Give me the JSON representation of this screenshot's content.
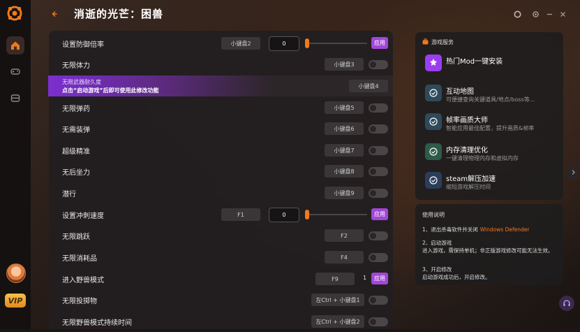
{
  "header": {
    "title": "消逝的光芒：困兽"
  },
  "colors": {
    "accent": "#a346d8",
    "orange": "#f07a1a"
  },
  "rows": [
    {
      "label": "设置防御倍率",
      "key": "小键盘2",
      "value": "0",
      "apply": "应用"
    },
    {
      "label": "无限体力",
      "key": "小键盘3"
    },
    {
      "label": "无限弹药",
      "key": "小键盘5"
    },
    {
      "label": "无需装弹",
      "key": "小键盘6"
    },
    {
      "label": "超级精准",
      "key": "小键盘7"
    },
    {
      "label": "无后坐力",
      "key": "小键盘8"
    },
    {
      "label": "潜行",
      "key": "小键盘9"
    },
    {
      "label": "设置冲刺速度",
      "key": "F1",
      "value": "0",
      "apply": "应用"
    },
    {
      "label": "无限跳跃",
      "key": "F2"
    },
    {
      "label": "无限消耗品",
      "key": "F4"
    },
    {
      "label": "进入野兽模式",
      "key": "F9",
      "value": "1",
      "apply": "应用"
    },
    {
      "label": "无限投掷物",
      "key": "左Ctrl + 小键盘1"
    },
    {
      "label": "无限野兽模式持续时间",
      "key": "左Ctrl + 小键盘2"
    }
  ],
  "highlight": {
    "line1": "无限武器耐久度",
    "line2": "点击“启动游戏”后即可使用此修改功能",
    "key": "小键盘4"
  },
  "services": {
    "title": "游戏服务",
    "items": [
      {
        "title": "热门Mod一键安装",
        "desc": "",
        "icon": "mod-icon"
      },
      {
        "title": "互动地图",
        "desc": "可便捷查询关键道具/地点/boss等...",
        "icon": "map-icon"
      },
      {
        "title": "帧率画质大师",
        "desc": "智能应用最佳配置，提升画质&帧率",
        "icon": "fps-icon"
      },
      {
        "title": "内存清理优化",
        "desc": "一键清理物理内存和虚拟内存",
        "icon": "memory-icon"
      },
      {
        "title": "steam解压加速",
        "desc": "缩短游戏解压时间",
        "icon": "steam-icon"
      }
    ]
  },
  "instructions": {
    "title": "使用说明",
    "s1_prefix": "1、退出杀毒软件并关闭",
    "s1_link": "Windows Defender",
    "s2_title": "2、启动游戏",
    "s2_body": "进入游戏，需保持单机；非正版游戏修改可能无法生效。",
    "s3_title": "3、开启修改",
    "s3_body": "启动游戏成功后，开启修改。"
  },
  "sidebar": {
    "vip_label": "VIP"
  }
}
